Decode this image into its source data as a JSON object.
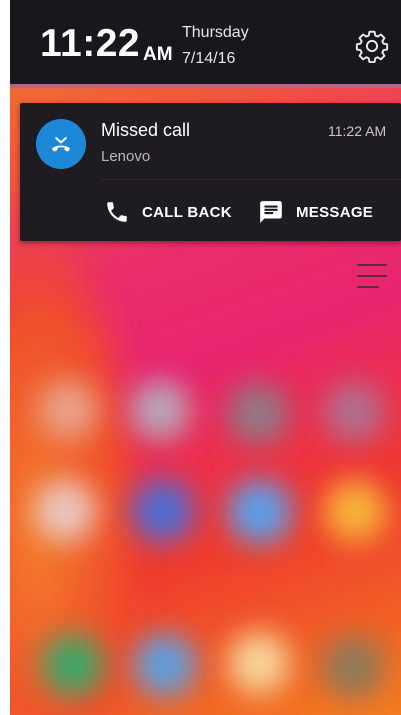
{
  "clock": {
    "time": "11:22",
    "ampm": "AM",
    "day": "Thursday",
    "date": "7/14/16"
  },
  "notification": {
    "title": "Missed call",
    "subtitle": "Lenovo",
    "time": "11:22 AM",
    "actions": [
      {
        "label": "CALL BACK",
        "icon": "phone-icon"
      },
      {
        "label": "MESSAGE",
        "icon": "message-icon"
      }
    ]
  },
  "icons": {
    "settings": "gear-icon",
    "avatar": "missed-call-icon",
    "menu": "menu-icon"
  },
  "colors": {
    "avatar": "#1e88d8",
    "panel": "#16181d",
    "card": "#1f1c21"
  }
}
